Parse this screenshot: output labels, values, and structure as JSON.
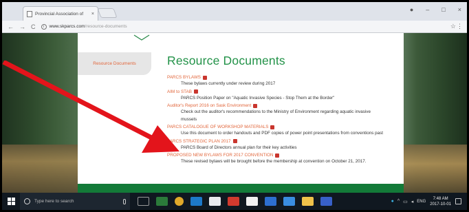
{
  "browser": {
    "tab_title": "Provincial Association of",
    "tab_close": "×",
    "url_domain": "www.skparcs.com",
    "url_path": "/resource-documents",
    "back_glyph": "←",
    "forward_glyph": "→",
    "reload_glyph": "C",
    "info_glyph": "i",
    "star_glyph": "☆",
    "menu_glyph": "⋮",
    "minimize_glyph": "–",
    "maximize_glyph": "□",
    "close_glyph": "×",
    "profile_glyph": "●"
  },
  "sidebar": {
    "active_label": "Resource Documents"
  },
  "main": {
    "heading": "Resource Documents",
    "documents": [
      {
        "title": "PARCS BYLAWS",
        "description": "These bylaws currently under review during 2017"
      },
      {
        "title": "AIM to STAB",
        "description": "PARCS Position Paper on \"Aquatic Invasive Species - Stop Them at the Border\""
      },
      {
        "title": "Auditor's Report 2016 on Sask Environment",
        "description": "Check out the auditor's recommendations to the Ministry of Environment regarding aquatic invasive mussels"
      },
      {
        "title": "PARCS CATALOGUE OF WORKSHOP MATERIALS",
        "description": "Use this document to order handouts and PDF copies of power point presentations from conventions past"
      },
      {
        "title": "PARCS STRATEGIC PLAN 2017",
        "description": "PARCS Board of Directors annual plan for their key activities"
      },
      {
        "title": "PROPOSED NEW BYLAWS FOR 2017 CONVENTION",
        "description": "These revised bylaws will be brought before the membership at convention on October 21, 2017."
      }
    ]
  },
  "taskbar": {
    "search_placeholder": "Type here to search",
    "lang": "ENG",
    "time": "7:48 AM",
    "date": "2017-10-01"
  },
  "colors": {
    "heading_green": "#229248",
    "link_orange": "#e1653a",
    "footer_green": "#137a38",
    "arrow_red": "#e3141b"
  },
  "icons": [
    "search-icon",
    "pdf-icon",
    "windows-start-icon",
    "arrow-annotation"
  ]
}
